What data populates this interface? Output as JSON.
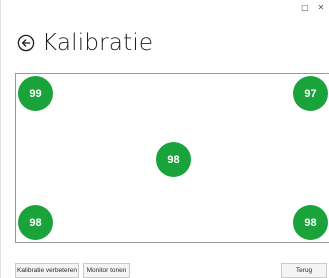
{
  "window": {
    "controls": {
      "maximize_glyph": "□",
      "close_glyph": "✕"
    }
  },
  "header": {
    "back_icon": "back-arrow-circle-icon",
    "title": "Kalibratie"
  },
  "calibration": {
    "point_color": "#1aa33a",
    "points": {
      "top_left": "99",
      "top_right": "97",
      "center": "98",
      "bottom_left": "98",
      "bottom_right": "98"
    }
  },
  "footer": {
    "improve_label": "Kalibratie verbeteren",
    "monitor_label": "Monitor tonen",
    "back_label": "Terug"
  }
}
